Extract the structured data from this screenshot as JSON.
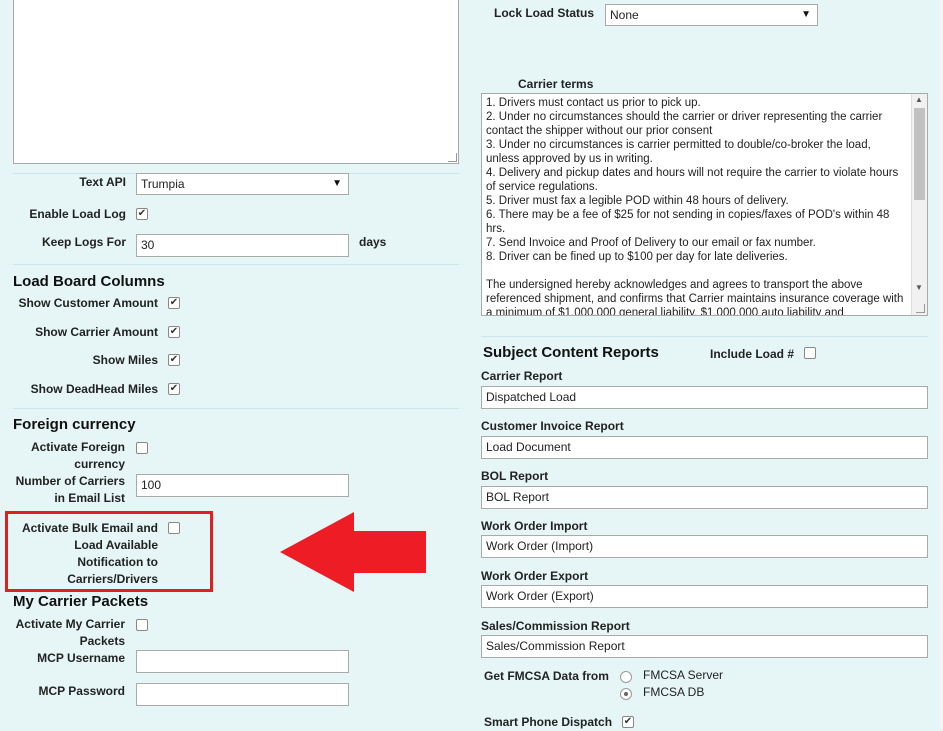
{
  "text_api": {
    "label": "Text API",
    "value": "Trumpia"
  },
  "enable_load_log": {
    "label": "Enable Load Log",
    "checked": true
  },
  "keep_logs": {
    "label": "Keep Logs For",
    "value": "30",
    "unit": "days"
  },
  "load_board": {
    "title": "Load Board Columns",
    "items": [
      {
        "label": "Show Customer Amount",
        "checked": true
      },
      {
        "label": "Show Carrier Amount",
        "checked": true
      },
      {
        "label": "Show Miles",
        "checked": true
      },
      {
        "label": "Show DeadHead Miles",
        "checked": true
      }
    ]
  },
  "foreign_currency": {
    "title": "Foreign currency",
    "activate_label_1": "Activate Foreign",
    "activate_label_2": "currency",
    "activate_checked": false,
    "carriers_label_1": "Number of Carriers",
    "carriers_label_2": "in Email List",
    "carriers_value": "100"
  },
  "bulk_email": {
    "line1": "Activate Bulk Email and",
    "line2": "Load Available",
    "line3": "Notification to",
    "line4": "Carriers/Drivers",
    "checked": false
  },
  "carrier_packets": {
    "title": "My Carrier Packets",
    "activate_label_1": "Activate My Carrier",
    "activate_label_2": "Packets",
    "activate_checked": false,
    "username_label": "MCP Username",
    "username_value": "",
    "password_label": "MCP Password",
    "password_value": ""
  },
  "lock_load_status": {
    "label": "Lock Load Status",
    "value": "None"
  },
  "carrier_terms": {
    "label": "Carrier terms",
    "text": "1. Drivers must contact us prior to pick up.\n2. Under no circumstances should the carrier or driver representing the carrier contact the shipper without our prior consent\n3. Under no circumstances is carrier permitted to double/co-broker the load, unless approved by us in writing.\n4. Delivery and pickup dates and hours will not require the carrier to violate hours of service regulations.\n5. Driver must fax a legible POD within 48 hours of delivery.\n6. There may be a fee of $25 for not sending in copies/faxes of POD's within 48 hrs.\n7. Send Invoice and Proof of Delivery to our email or fax number.\n8. Driver can be fined up to $100 per day for late deliveries.\n\nThe undersigned hereby acknowledges and agrees to transport the above referenced shipment, and confirms that Carrier maintains insurance coverage with a minimum of $1,000,000 general liability, $1,000,000 auto liability and"
  },
  "subject_reports": {
    "title": "Subject Content Reports",
    "include_load_label": "Include Load #",
    "include_load_checked": false,
    "reports": [
      {
        "label": "Carrier Report",
        "value": "Dispatched Load"
      },
      {
        "label": "Customer Invoice Report",
        "value": "Load Document"
      },
      {
        "label": "BOL Report",
        "value": "BOL Report"
      },
      {
        "label": "Work Order Import",
        "value": "Work Order (Import)"
      },
      {
        "label": "Work Order Export",
        "value": "Work Order (Export)"
      },
      {
        "label": "Sales/Commission Report",
        "value": "Sales/Commission Report"
      }
    ]
  },
  "fmcsa": {
    "label": "Get FMCSA Data from",
    "options": [
      {
        "label": "FMCSA Server",
        "selected": false
      },
      {
        "label": "FMCSA DB",
        "selected": true
      }
    ]
  },
  "smart_phone": {
    "label": "Smart Phone Dispatch",
    "checked": true
  },
  "colors": {
    "background": "#e6f6f7",
    "highlight_box": "#e02020",
    "arrow": "#ee1c24"
  }
}
